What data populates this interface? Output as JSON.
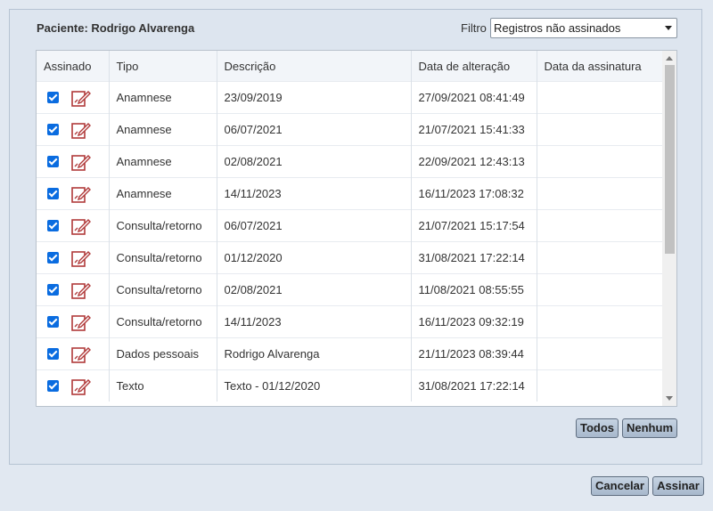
{
  "patient": {
    "label": "Paciente: Rodrigo Alvarenga"
  },
  "filter": {
    "label": "Filtro",
    "selected": "Registros não assinados"
  },
  "columns": [
    "Assinado",
    "Tipo",
    "Descrição",
    "Data de alteração",
    "Data da assinatura"
  ],
  "rows": [
    {
      "signed": true,
      "tipo": "Anamnese",
      "descricao": "23/09/2019",
      "alteracao": "27/09/2021 08:41:49",
      "assinatura": ""
    },
    {
      "signed": true,
      "tipo": "Anamnese",
      "descricao": "06/07/2021",
      "alteracao": "21/07/2021 15:41:33",
      "assinatura": ""
    },
    {
      "signed": true,
      "tipo": "Anamnese",
      "descricao": "02/08/2021",
      "alteracao": "22/09/2021 12:43:13",
      "assinatura": ""
    },
    {
      "signed": true,
      "tipo": "Anamnese",
      "descricao": "14/11/2023",
      "alteracao": "16/11/2023 17:08:32",
      "assinatura": ""
    },
    {
      "signed": true,
      "tipo": "Consulta/retorno",
      "descricao": "06/07/2021",
      "alteracao": "21/07/2021 15:17:54",
      "assinatura": ""
    },
    {
      "signed": true,
      "tipo": "Consulta/retorno",
      "descricao": "01/12/2020",
      "alteracao": "31/08/2021 17:22:14",
      "assinatura": ""
    },
    {
      "signed": true,
      "tipo": "Consulta/retorno",
      "descricao": "02/08/2021",
      "alteracao": "11/08/2021 08:55:55",
      "assinatura": ""
    },
    {
      "signed": true,
      "tipo": "Consulta/retorno",
      "descricao": "14/11/2023",
      "alteracao": "16/11/2023 09:32:19",
      "assinatura": ""
    },
    {
      "signed": true,
      "tipo": "Dados pessoais",
      "descricao": "Rodrigo Alvarenga",
      "alteracao": "21/11/2023 08:39:44",
      "assinatura": ""
    },
    {
      "signed": true,
      "tipo": "Texto",
      "descricao": "Texto - 01/12/2020",
      "alteracao": "31/08/2021 17:22:14",
      "assinatura": ""
    }
  ],
  "buttons": {
    "todos": "Todos",
    "nenhum": "Nenhum",
    "cancelar": "Cancelar",
    "assinar": "Assinar"
  },
  "colors": {
    "checkbox": "#0a6ce0",
    "sign_icon": "#b03a3a",
    "background": "#e1e8f1"
  },
  "icons": {
    "row_icon": "sign-document-icon"
  }
}
